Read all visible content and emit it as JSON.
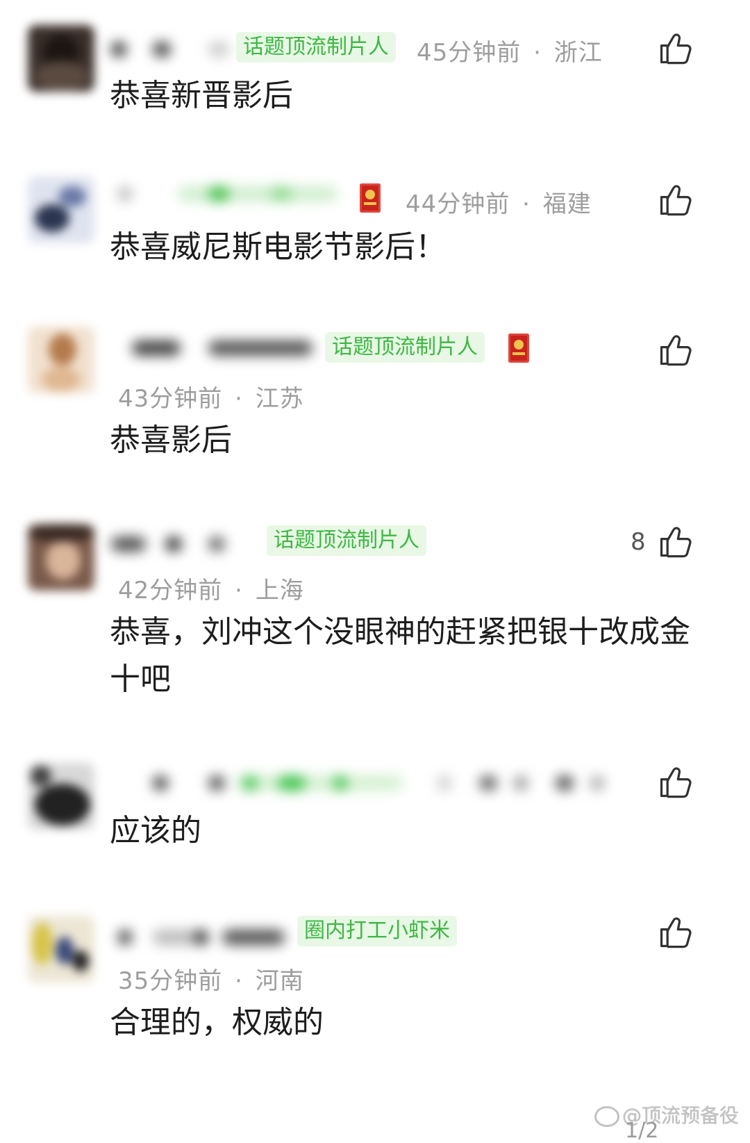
{
  "comments": [
    {
      "tag": "话题顶流制片人",
      "time": "45分钟前",
      "location": "浙江",
      "text": "恭喜新晋影后",
      "likes": "",
      "has_badge": false
    },
    {
      "tag": "",
      "time": "44分钟前",
      "location": "福建",
      "text": "恭喜威尼斯电影节影后！",
      "likes": "",
      "has_badge": true
    },
    {
      "tag": "话题顶流制片人",
      "time": "43分钟前",
      "location": "江苏",
      "text": "恭喜影后",
      "likes": "",
      "has_badge": true
    },
    {
      "tag": "话题顶流制片人",
      "time": "42分钟前",
      "location": "上海",
      "text": "恭喜，刘冲这个没眼神的赶紧把银十改成金十吧",
      "likes": "8",
      "has_badge": false
    },
    {
      "tag": "",
      "time": "",
      "location": "",
      "text": "应该的",
      "likes": "",
      "has_badge": false
    },
    {
      "tag": "圈内打工小虾米",
      "time": "35分钟前",
      "location": "河南",
      "text": "合理的，权威的",
      "likes": "",
      "has_badge": false
    }
  ],
  "meta_separator": "·",
  "watermark": "@顶流预备役",
  "page_indicator": "1/2",
  "icons": {
    "like": "thumbs-up-icon",
    "badge": "red-book-badge-icon"
  },
  "colors": {
    "tag_bg": "#e9f8e6",
    "tag_text": "#3cb842",
    "meta_text": "#9d9d9d",
    "badge": "#c9241c"
  }
}
